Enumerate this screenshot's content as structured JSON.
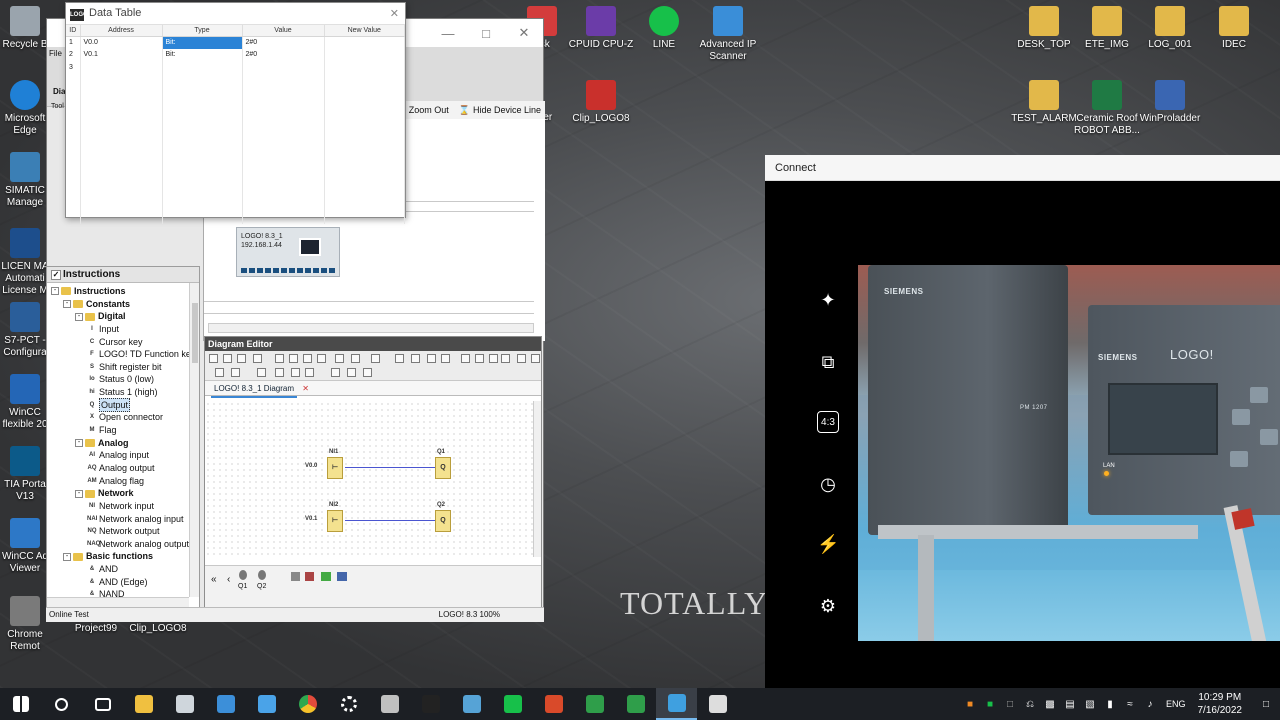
{
  "desktop": {
    "left_icons": [
      {
        "label": "Recycle B",
        "color": "#9aa4ad"
      },
      {
        "label": "Microsoft Edge",
        "color": "#1f80d6"
      },
      {
        "label": "SIMATIC Manage",
        "color": "#3b7fb5"
      },
      {
        "label": "LICEN MA Automati License M",
        "color": "#1d4e8c"
      },
      {
        "label": "S7-PCT - Configura",
        "color": "#2a5e9a"
      },
      {
        "label": "WinCC flexible 20",
        "color": "#2466b6"
      },
      {
        "label": "TIA Porta V13",
        "color": "#0c5a89"
      },
      {
        "label": "WinCC Ad Viewer",
        "color": "#2d78c7"
      },
      {
        "label": "Chrome Remot",
        "color": "#7a7a7a"
      }
    ],
    "top_icons": [
      {
        "label": "esk",
        "color": "#d33c3c"
      },
      {
        "label": "CPUID CPU-Z",
        "color": "#6b3ca8"
      },
      {
        "label": "LINE",
        "color": "#17c04a"
      },
      {
        "label": "Advanced IP Scanner",
        "color": "#3a8ed8"
      },
      {
        "label": "DESK_TOP",
        "color": "#e2b84a"
      },
      {
        "label": "ETE_IMG",
        "color": "#e2b84a"
      },
      {
        "label": "LOG_001",
        "color": "#e2b84a"
      },
      {
        "label": "IDEC",
        "color": "#e2b84a"
      },
      {
        "label": "Clip_LOGO8",
        "color": "#c9302c"
      },
      {
        "label": "TEST_ALARM",
        "color": "#e2b84a"
      },
      {
        "label": "Ceramic Roof ROBOT ABB...",
        "color": "#1f7a44"
      },
      {
        "label": "WinProladder",
        "color": "#3a66b2"
      },
      {
        "label": "Project99",
        "color": ""
      },
      {
        "label": "Clip_LOGO8",
        "color": ""
      }
    ],
    "partial_icon_text": "y ger",
    "watermark": "TOTALLY"
  },
  "data_table": {
    "title": "Data Table",
    "columns": [
      "ID",
      "Address",
      "Type",
      "Value",
      "New Value"
    ],
    "rows": [
      {
        "id": "1",
        "address": "V0.0",
        "type": "Bit:",
        "value": "2#0",
        "new_value": ""
      },
      {
        "id": "2",
        "address": "V0.1",
        "type": "Bit:",
        "value": "2#0",
        "new_value": ""
      },
      {
        "id": "3",
        "address": "",
        "type": "",
        "value": "",
        "new_value": ""
      }
    ]
  },
  "main_window": {
    "fragments": [
      "File",
      "Dia",
      "Tool"
    ],
    "toolbar": {
      "zoom_in": "In",
      "zoom_out": "Zoom Out",
      "hide_device_line": "Hide Device Line"
    },
    "device": {
      "name": "LOGO! 8.3_1",
      "ip": "192.168.1.44"
    },
    "instructions": {
      "title": "Instructions",
      "tree": [
        {
          "label": "Instructions",
          "level": 0,
          "type": "folder",
          "bold": true
        },
        {
          "label": "Constants",
          "level": 1,
          "type": "folder",
          "bold": true
        },
        {
          "label": "Digital",
          "level": 2,
          "type": "folder",
          "bold": true
        },
        {
          "label": "Input",
          "level": 3,
          "type": "item",
          "icon": "I"
        },
        {
          "label": "Cursor key",
          "level": 3,
          "type": "item",
          "icon": "C"
        },
        {
          "label": "LOGO! TD Function key",
          "level": 3,
          "type": "item",
          "icon": "F"
        },
        {
          "label": "Shift register bit",
          "level": 3,
          "type": "item",
          "icon": "S"
        },
        {
          "label": "Status 0 (low)",
          "level": 3,
          "type": "item",
          "icon": "lo"
        },
        {
          "label": "Status 1 (high)",
          "level": 3,
          "type": "item",
          "icon": "hi"
        },
        {
          "label": "Output",
          "level": 3,
          "type": "item",
          "icon": "Q",
          "selected": true
        },
        {
          "label": "Open connector",
          "level": 3,
          "type": "item",
          "icon": "X"
        },
        {
          "label": "Flag",
          "level": 3,
          "type": "item",
          "icon": "M"
        },
        {
          "label": "Analog",
          "level": 2,
          "type": "folder",
          "bold": true
        },
        {
          "label": "Analog input",
          "level": 3,
          "type": "item",
          "icon": "AI"
        },
        {
          "label": "Analog output",
          "level": 3,
          "type": "item",
          "icon": "AQ"
        },
        {
          "label": "Analog flag",
          "level": 3,
          "type": "item",
          "icon": "AM"
        },
        {
          "label": "Network",
          "level": 2,
          "type": "folder",
          "bold": true
        },
        {
          "label": "Network input",
          "level": 3,
          "type": "item",
          "icon": "NI"
        },
        {
          "label": "Network analog input",
          "level": 3,
          "type": "item",
          "icon": "NAI"
        },
        {
          "label": "Network output",
          "level": 3,
          "type": "item",
          "icon": "NQ"
        },
        {
          "label": "Network analog output",
          "level": 3,
          "type": "item",
          "icon": "NAQ"
        },
        {
          "label": "Basic functions",
          "level": 1,
          "type": "folder",
          "bold": true
        },
        {
          "label": "AND",
          "level": 3,
          "type": "item",
          "icon": "&"
        },
        {
          "label": "AND (Edge)",
          "level": 3,
          "type": "item",
          "icon": "&"
        },
        {
          "label": "NAND",
          "level": 3,
          "type": "item",
          "icon": "&"
        }
      ]
    },
    "diagram_editor": {
      "title": "Diagram Editor",
      "tab": "LOGO! 8.3_1 Diagram",
      "blocks": [
        {
          "name": "NI1",
          "pin": "V0.0",
          "label": ""
        },
        {
          "name": "Q1",
          "pin": "",
          "label": "Q"
        },
        {
          "name": "NI2",
          "pin": "V0.1",
          "label": ""
        },
        {
          "name": "Q2",
          "pin": "",
          "label": "Q"
        }
      ],
      "bottom_labels": [
        "Q1",
        "Q2"
      ]
    },
    "status": {
      "left": "Online Test",
      "right": "LOGO! 8.3  100%"
    }
  },
  "connect_window": {
    "title": "Connect",
    "side_icons": [
      "sparkle-icon",
      "camera-switch-icon",
      "aspect-ratio-icon",
      "timer-icon",
      "flash-off-icon",
      "settings-icon"
    ],
    "aspect_label": "4:3",
    "photo_text": {
      "brand1": "SIEMENS",
      "brand2": "SIEMENS",
      "logo": "LOGO!",
      "module": "PM 1207",
      "lan": "LAN"
    }
  },
  "taskbar": {
    "apps": [
      {
        "name": "start",
        "color": "#ffffff"
      },
      {
        "name": "search",
        "color": "#ffffff"
      },
      {
        "name": "task-view",
        "color": "#ffffff"
      },
      {
        "name": "file-explorer",
        "color": "#f0c040"
      },
      {
        "name": "camera",
        "color": "#cfd6dc"
      },
      {
        "name": "calculator",
        "color": "#3c8fd9"
      },
      {
        "name": "barcode-app",
        "color": "#4aa3e8"
      },
      {
        "name": "chrome",
        "color": "#e24b3b"
      },
      {
        "name": "settings",
        "color": "#ffffff"
      },
      {
        "name": "scanner",
        "color": "#c0c0c0"
      },
      {
        "name": "terminal",
        "color": "#222222"
      },
      {
        "name": "monitor-app",
        "color": "#56a3d6"
      },
      {
        "name": "line",
        "color": "#17c04a"
      },
      {
        "name": "grid-app",
        "color": "#d94a2a"
      },
      {
        "name": "green-app",
        "color": "#2f9e4a"
      },
      {
        "name": "notepad-app",
        "color": "#2f9e4a"
      },
      {
        "name": "connect-app",
        "color": "#3fa0e0"
      },
      {
        "name": "logo-soft",
        "color": "#dddddd"
      }
    ],
    "language": "ENG",
    "time": "10:29 PM",
    "date": "7/16/2022"
  }
}
